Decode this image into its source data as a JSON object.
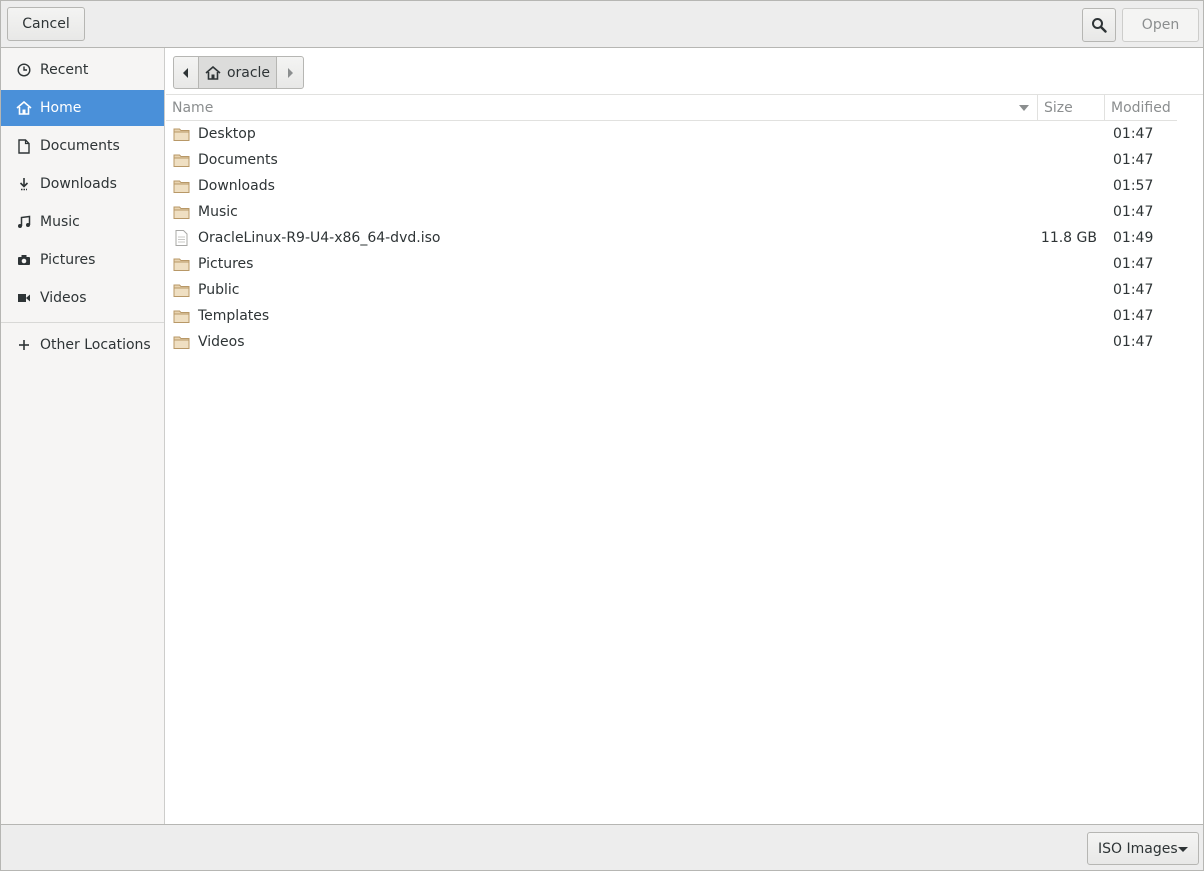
{
  "header": {
    "cancel_label": "Cancel",
    "open_label": "Open",
    "search_icon": "search-icon"
  },
  "sidebar": {
    "items": [
      {
        "label": "Recent",
        "icon": "clock-icon",
        "selected": false
      },
      {
        "label": "Home",
        "icon": "home-icon",
        "selected": true
      },
      {
        "label": "Documents",
        "icon": "document-icon",
        "selected": false
      },
      {
        "label": "Downloads",
        "icon": "download-icon",
        "selected": false
      },
      {
        "label": "Music",
        "icon": "music-icon",
        "selected": false
      },
      {
        "label": "Pictures",
        "icon": "camera-icon",
        "selected": false
      },
      {
        "label": "Videos",
        "icon": "video-icon",
        "selected": false
      }
    ],
    "other_locations": {
      "label": "Other Locations",
      "icon": "plus-icon"
    }
  },
  "pathbar": {
    "current": "oracle",
    "icon": "home-icon"
  },
  "filelist": {
    "columns": {
      "name": "Name",
      "size": "Size",
      "modified": "Modified"
    },
    "rows": [
      {
        "name": "Desktop",
        "type": "folder",
        "size": "",
        "modified": "01:47"
      },
      {
        "name": "Documents",
        "type": "folder",
        "size": "",
        "modified": "01:47"
      },
      {
        "name": "Downloads",
        "type": "folder",
        "size": "",
        "modified": "01:57"
      },
      {
        "name": "Music",
        "type": "folder",
        "size": "",
        "modified": "01:47"
      },
      {
        "name": "OracleLinux-R9-U4-x86_64-dvd.iso",
        "type": "file",
        "size": "11.8 GB",
        "modified": "01:49"
      },
      {
        "name": "Pictures",
        "type": "folder",
        "size": "",
        "modified": "01:47"
      },
      {
        "name": "Public",
        "type": "folder",
        "size": "",
        "modified": "01:47"
      },
      {
        "name": "Templates",
        "type": "folder",
        "size": "",
        "modified": "01:47"
      },
      {
        "name": "Videos",
        "type": "folder",
        "size": "",
        "modified": "01:47"
      }
    ]
  },
  "footer": {
    "filter_label": "ISO Images"
  },
  "colors": {
    "accent": "#4a90d9",
    "folder": "#d8b98a",
    "text": "#2e3436",
    "muted": "#8b8e8f"
  }
}
